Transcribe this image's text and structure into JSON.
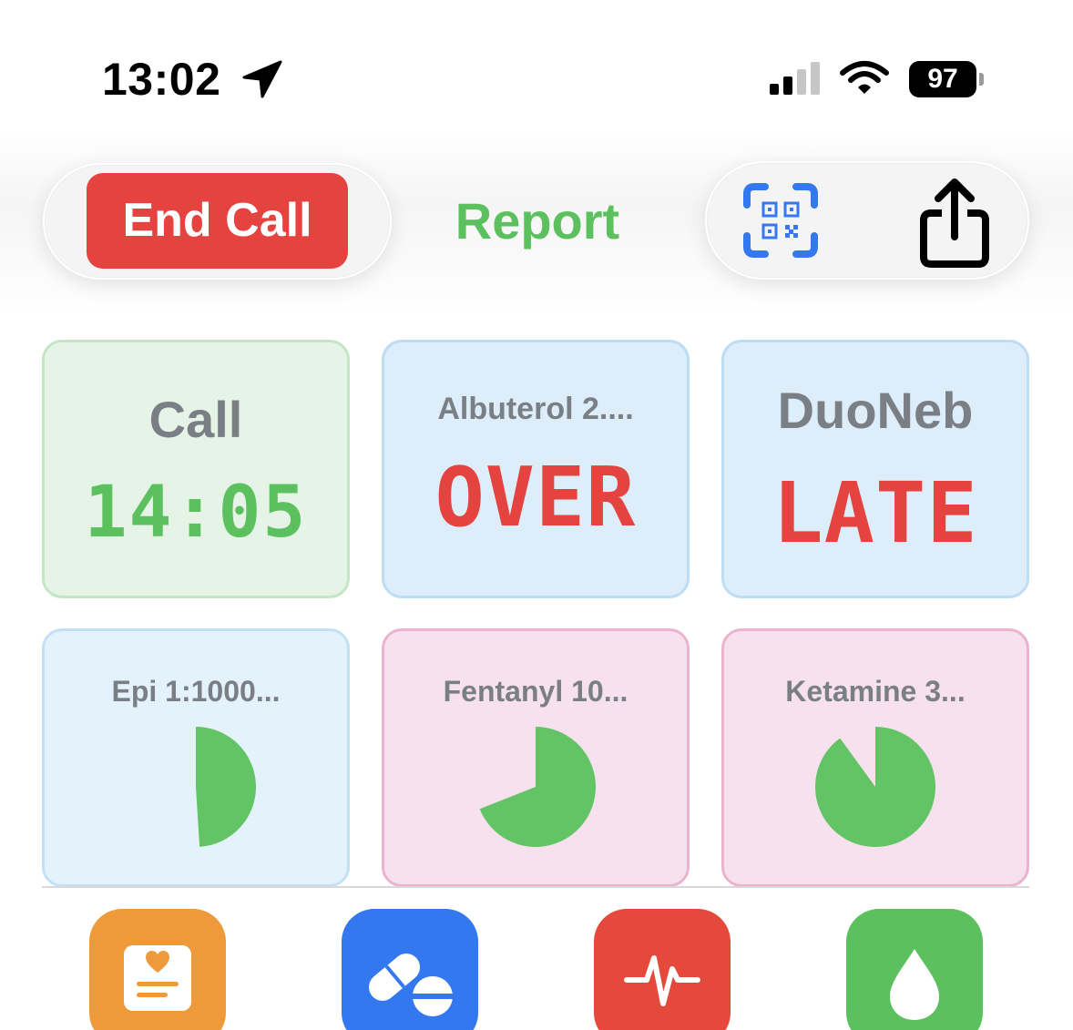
{
  "status_bar": {
    "time": "13:02",
    "battery": "97",
    "icons": [
      "location-arrow-icon",
      "cellular-signal-icon",
      "wifi-icon",
      "battery-icon"
    ]
  },
  "toolbar": {
    "end_call_label": "End Call",
    "title": "Report",
    "icons": [
      "qr-scan-icon",
      "share-icon"
    ]
  },
  "tiles": [
    {
      "label": "Call",
      "value": "14:05",
      "color": "#5cc05e"
    },
    {
      "label": "Albuterol 2....",
      "value": "OVER",
      "color": "#e5433f"
    },
    {
      "label": "DuoNeb",
      "value": "LATE",
      "color": "#e5433f"
    },
    {
      "label": "Epi 1:1000...",
      "progress": 0.49
    },
    {
      "label": "Fentanyl 10...",
      "progress": 0.69
    },
    {
      "label": "Ketamine 3...",
      "progress": 0.9
    }
  ],
  "tab_bar": {
    "icons": [
      "patient-card-icon",
      "pills-icon",
      "heartbeat-icon",
      "fluid-drop-icon"
    ]
  },
  "colors": {
    "accent_green": "#5cc05e",
    "alert_red": "#e5433f",
    "qr_blue": "#3478f0",
    "orange": "#ef9a3a"
  }
}
